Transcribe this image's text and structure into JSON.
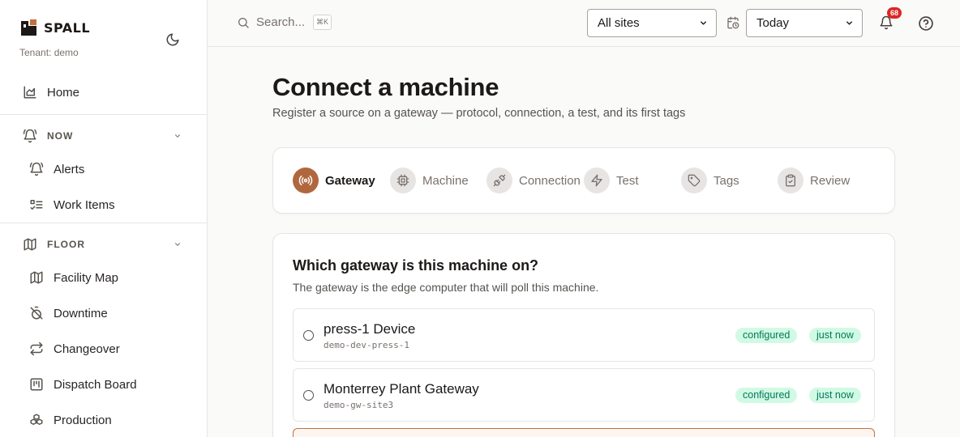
{
  "brand": {
    "name": "SPALL",
    "tenant": "Tenant: demo"
  },
  "sidebar": {
    "home": "Home",
    "sections": [
      {
        "label": "NOW",
        "items": [
          "Alerts",
          "Work Items"
        ]
      },
      {
        "label": "FLOOR",
        "items": [
          "Facility Map",
          "Downtime",
          "Changeover",
          "Dispatch Board",
          "Production"
        ]
      }
    ]
  },
  "topbar": {
    "search_placeholder": "Search...",
    "shortcut": "⌘K",
    "site_select": "All sites",
    "range_select": "Today",
    "notification_count": "68"
  },
  "page": {
    "title": "Connect a machine",
    "subtitle": "Register a source on a gateway — protocol, connection, a test, and its first tags"
  },
  "steps": [
    {
      "label": "Gateway",
      "icon": "radio-broadcast-icon",
      "active": true
    },
    {
      "label": "Machine",
      "icon": "cpu-icon",
      "active": false
    },
    {
      "label": "Connection",
      "icon": "plug-icon",
      "active": false
    },
    {
      "label": "Test",
      "icon": "lightning-icon",
      "active": false
    },
    {
      "label": "Tags",
      "icon": "tag-icon",
      "active": false
    },
    {
      "label": "Review",
      "icon": "clipboard-check-icon",
      "active": false
    }
  ],
  "gateway_card": {
    "title": "Which gateway is this machine on?",
    "description": "The gateway is the edge computer that will poll this machine.",
    "options": [
      {
        "name": "press-1 Device",
        "id": "demo-dev-press-1",
        "status": "configured",
        "seen": "just now"
      },
      {
        "name": "Monterrey Plant Gateway",
        "id": "demo-gw-site3",
        "status": "configured",
        "seen": "just now"
      }
    ]
  },
  "colors": {
    "accent": "#b0673d",
    "badge": "#dc2626",
    "status_bg": "#d1fae5",
    "status_text": "#047857"
  }
}
